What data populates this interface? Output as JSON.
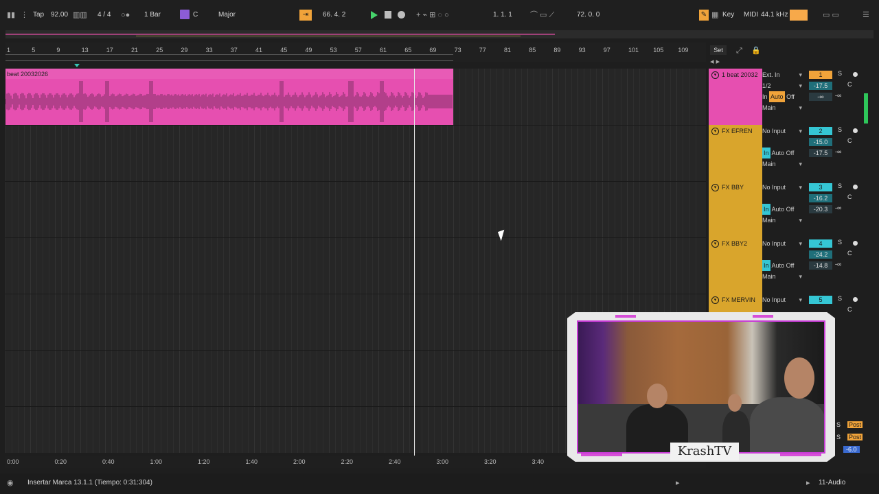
{
  "transport": {
    "tap": "Tap",
    "tempo": "92.00",
    "signature": "4 / 4",
    "quantize": "1 Bar",
    "key_root": "C",
    "scale": "Major",
    "position": "66.  4.  2",
    "loop_start": "1.  1.  1",
    "loop_length": "72.  0.  0",
    "key_label": "Key",
    "midi_label": "MIDI",
    "sample_rate": "44.1 kHz"
  },
  "ruler": {
    "bars": [
      "1",
      "5",
      "9",
      "13",
      "17",
      "21",
      "25",
      "29",
      "33",
      "37",
      "41",
      "45",
      "49",
      "53",
      "57",
      "61",
      "65",
      "69",
      "73",
      "77",
      "81",
      "85",
      "89",
      "93",
      "97",
      "101",
      "105",
      "109"
    ],
    "set_label": "Set"
  },
  "timeline": {
    "times": [
      "0:00",
      "0:20",
      "0:40",
      "1:00",
      "1:20",
      "1:40",
      "2:00",
      "2:20",
      "2:40",
      "3:00",
      "3:20",
      "3:40"
    ]
  },
  "clip": {
    "name": "beat 20032026",
    "color": "#e64fb0"
  },
  "tracks": [
    {
      "name": "1 beat 20032",
      "color": "#e64fb0",
      "input": "Ext. In",
      "channel": "1/2",
      "output": "Main",
      "num": "1",
      "num_color": "orange",
      "vol": "-17.5",
      "pan": "C",
      "extra_a": "-∞",
      "extra_b": "-∞",
      "monitor_in": "In",
      "monitor_auto": "Auto",
      "monitor_off": "Off"
    },
    {
      "name": "FX EFREN",
      "color": "#d9a52c",
      "input": "No Input",
      "channel": "",
      "output": "Main",
      "num": "2",
      "num_color": "cyan",
      "vol": "-15.0",
      "pan": "C",
      "extra_a": "-17.5",
      "extra_b": "-∞",
      "monitor_in": "In",
      "monitor_auto": "Auto",
      "monitor_off": "Off"
    },
    {
      "name": "FX BBY",
      "color": "#d9a52c",
      "input": "No Input",
      "channel": "",
      "output": "Main",
      "num": "3",
      "num_color": "cyan",
      "vol": "-16.2",
      "pan": "C",
      "extra_a": "-20.3",
      "extra_b": "-∞",
      "monitor_in": "In",
      "monitor_auto": "Auto",
      "monitor_off": "Off"
    },
    {
      "name": "FX BBY2",
      "color": "#d9a52c",
      "input": "No Input",
      "channel": "",
      "output": "Main",
      "num": "4",
      "num_color": "cyan",
      "vol": "-24.2",
      "pan": "C",
      "extra_a": "-14.8",
      "extra_b": "-∞",
      "monitor_in": "In",
      "monitor_auto": "Auto",
      "monitor_off": "Off"
    },
    {
      "name": "FX MERVIN",
      "color": "#d9a52c",
      "input": "No Input",
      "channel": "",
      "output": "",
      "num": "5",
      "num_color": "cyan",
      "vol": "",
      "pan": "C",
      "extra_a": "",
      "extra_b": "-∞",
      "monitor_in": "",
      "monitor_auto": "",
      "monitor_off": ""
    }
  ],
  "returns": {
    "post_a": "Post",
    "post_b": "Post",
    "master_vol": "-6.0",
    "s": "S"
  },
  "webcam": {
    "brand": "KrashTV"
  },
  "status": {
    "message": "Insertar Marca 13.1.1 (Tiempo: 0:31:304)",
    "track": "11-Audio"
  },
  "colors": {
    "accent_orange": "#f0a33a",
    "track_pink": "#e64fb0",
    "track_gold": "#d9a52c",
    "cyan": "#35c6d4",
    "play_green": "#46d36b"
  }
}
